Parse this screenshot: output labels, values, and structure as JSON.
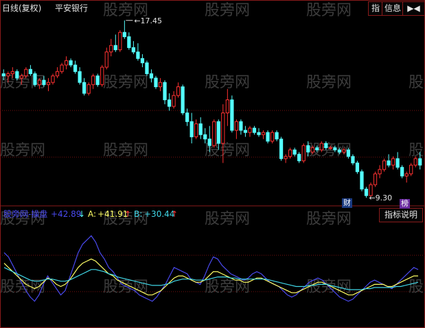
{
  "header": {
    "period_label": "日线(复权)",
    "stock_name": "平安银行"
  },
  "toolbar": {
    "zhi_label": "指",
    "info_label": "信息",
    "arrows_label": "▶◀"
  },
  "price_panel": {
    "max_label": "17.45",
    "min_label": "9.30",
    "badge_cai": "财",
    "badge_bang": "榜"
  },
  "indicator_panel": {
    "name": "股旁网-操盘",
    "value_main": "+42.89",
    "label_a": "A:",
    "value_a": "+41.91",
    "label_b": "B:",
    "value_b": "+30.44",
    "explain_button": "指标说明"
  },
  "watermark": "股旁网",
  "colors": {
    "up": "#ff3232",
    "down": "#54ffff",
    "main_line": "#4a4af0",
    "a_line": "#ffff66",
    "b_line": "#40d8e8",
    "grid": "#7a1010",
    "panel_border": "#8a1a1a"
  },
  "chart_data": [
    {
      "type": "candlestick",
      "title": "平安银行 日线(复权)",
      "x": "trading days 1-96",
      "ohlc": [
        [
          15.0,
          15.2,
          14.7,
          14.9
        ],
        [
          14.9,
          15.1,
          14.6,
          15.0
        ],
        [
          15.0,
          15.3,
          14.8,
          15.1
        ],
        [
          15.1,
          15.2,
          14.7,
          14.8
        ],
        [
          14.8,
          15.0,
          14.5,
          14.9
        ],
        [
          14.9,
          15.3,
          14.8,
          15.2
        ],
        [
          15.2,
          15.4,
          14.9,
          15.0
        ],
        [
          15.0,
          15.1,
          14.4,
          14.5
        ],
        [
          14.5,
          14.8,
          14.3,
          14.7
        ],
        [
          14.7,
          14.9,
          14.4,
          14.5
        ],
        [
          14.5,
          14.8,
          14.2,
          14.6
        ],
        [
          14.6,
          15.0,
          14.5,
          14.9
        ],
        [
          14.9,
          15.3,
          14.8,
          15.1
        ],
        [
          15.1,
          15.5,
          15.0,
          15.4
        ],
        [
          15.4,
          15.8,
          15.2,
          15.6
        ],
        [
          15.6,
          15.7,
          15.3,
          15.4
        ],
        [
          15.4,
          15.6,
          15.0,
          15.1
        ],
        [
          15.1,
          15.3,
          14.5,
          14.6
        ],
        [
          14.6,
          14.8,
          14.0,
          14.1
        ],
        [
          14.1,
          14.6,
          14.0,
          14.5
        ],
        [
          14.5,
          15.0,
          14.3,
          14.9
        ],
        [
          14.9,
          15.0,
          14.4,
          14.5
        ],
        [
          14.5,
          15.4,
          14.4,
          15.3
        ],
        [
          15.3,
          16.2,
          15.2,
          16.0
        ],
        [
          16.0,
          16.6,
          15.8,
          16.3
        ],
        [
          16.3,
          16.8,
          16.0,
          16.1
        ],
        [
          16.1,
          17.0,
          16.0,
          16.9
        ],
        [
          16.9,
          17.45,
          16.6,
          16.7
        ],
        [
          16.7,
          16.9,
          16.1,
          16.2
        ],
        [
          16.2,
          16.5,
          15.9,
          16.0
        ],
        [
          16.0,
          16.4,
          15.6,
          15.7
        ],
        [
          15.7,
          15.9,
          15.3,
          15.5
        ],
        [
          15.5,
          15.6,
          14.9,
          15.0
        ],
        [
          15.0,
          15.2,
          14.6,
          14.8
        ],
        [
          14.8,
          14.9,
          14.3,
          14.4
        ],
        [
          14.4,
          14.8,
          14.2,
          14.6
        ],
        [
          14.6,
          14.7,
          13.6,
          13.8
        ],
        [
          13.8,
          14.1,
          13.3,
          13.5
        ],
        [
          13.5,
          14.2,
          13.4,
          14.0
        ],
        [
          14.0,
          14.6,
          13.9,
          14.4
        ],
        [
          14.4,
          14.5,
          13.1,
          13.2
        ],
        [
          13.2,
          13.4,
          12.6,
          12.8
        ],
        [
          12.8,
          13.2,
          11.8,
          12.1
        ],
        [
          12.1,
          12.9,
          12.0,
          12.7
        ],
        [
          12.7,
          13.0,
          12.0,
          12.2
        ],
        [
          12.2,
          12.5,
          11.8,
          12.0
        ],
        [
          12.0,
          12.6,
          11.4,
          11.7
        ],
        [
          11.7,
          12.9,
          11.6,
          12.8
        ],
        [
          12.8,
          12.9,
          11.5,
          11.8
        ],
        [
          11.8,
          13.6,
          10.9,
          13.2
        ],
        [
          13.2,
          14.3,
          12.6,
          13.8
        ],
        [
          13.8,
          14.0,
          12.3,
          12.4
        ],
        [
          12.4,
          12.9,
          12.0,
          12.8
        ],
        [
          12.8,
          12.9,
          12.2,
          12.4
        ],
        [
          12.4,
          12.6,
          12.1,
          12.3
        ],
        [
          12.3,
          12.6,
          12.1,
          12.5
        ],
        [
          12.5,
          12.6,
          12.2,
          12.3
        ],
        [
          12.3,
          12.5,
          12.1,
          12.2
        ],
        [
          12.2,
          12.4,
          12.0,
          12.3
        ],
        [
          12.3,
          12.4,
          11.8,
          11.9
        ],
        [
          11.9,
          12.4,
          11.8,
          12.3
        ],
        [
          12.3,
          12.4,
          11.9,
          12.0
        ],
        [
          12.0,
          12.1,
          11.0,
          11.1
        ],
        [
          11.1,
          11.3,
          10.9,
          11.2
        ],
        [
          11.2,
          11.6,
          11.1,
          11.5
        ],
        [
          11.5,
          11.6,
          11.2,
          11.3
        ],
        [
          11.3,
          11.4,
          10.9,
          11.0
        ],
        [
          11.0,
          11.8,
          10.9,
          11.7
        ],
        [
          11.7,
          11.9,
          11.2,
          11.4
        ],
        [
          11.4,
          11.7,
          11.3,
          11.6
        ],
        [
          11.6,
          11.7,
          11.4,
          11.5
        ],
        [
          11.5,
          11.9,
          11.4,
          11.8
        ],
        [
          11.8,
          11.9,
          11.5,
          11.6
        ],
        [
          11.6,
          11.7,
          11.5,
          11.6
        ],
        [
          11.6,
          11.7,
          11.4,
          11.5
        ],
        [
          11.5,
          11.6,
          11.3,
          11.4
        ],
        [
          11.4,
          11.6,
          11.3,
          11.5
        ],
        [
          11.5,
          11.6,
          11.1,
          11.2
        ],
        [
          11.2,
          11.3,
          10.8,
          10.9
        ],
        [
          10.9,
          11.0,
          10.4,
          10.5
        ],
        [
          10.5,
          10.6,
          9.6,
          9.7
        ],
        [
          9.7,
          9.8,
          9.3,
          9.4
        ],
        [
          9.4,
          10.0,
          9.35,
          9.9
        ],
        [
          9.9,
          10.5,
          9.8,
          10.4
        ],
        [
          10.4,
          10.8,
          10.2,
          10.6
        ],
        [
          10.6,
          11.1,
          10.5,
          11.0
        ],
        [
          11.0,
          11.3,
          10.7,
          10.8
        ],
        [
          10.8,
          11.2,
          10.6,
          11.1
        ],
        [
          11.1,
          11.4,
          10.6,
          10.7
        ],
        [
          10.7,
          10.8,
          10.2,
          10.3
        ],
        [
          10.3,
          10.5,
          10.0,
          10.4
        ],
        [
          10.4,
          10.9,
          10.3,
          10.8
        ],
        [
          10.8,
          11.2,
          10.7,
          11.1
        ],
        [
          11.1,
          11.4,
          10.6,
          10.8
        ]
      ],
      "annotations": [
        {
          "label": "17.45",
          "value": 17.45
        },
        {
          "label": "9.30",
          "value": 9.3
        }
      ],
      "xlabel": "",
      "ylabel": ""
    },
    {
      "type": "line",
      "title": "股旁网-操盘",
      "ylim": [
        0,
        100
      ],
      "series": [
        {
          "name": "main",
          "values": [
            70,
            66,
            58,
            50,
            42,
            34,
            28,
            24,
            30,
            40,
            48,
            42,
            36,
            30,
            34,
            46,
            58,
            70,
            78,
            82,
            86,
            80,
            70,
            64,
            56,
            52,
            46,
            40,
            38,
            36,
            34,
            30,
            28,
            26,
            24,
            28,
            34,
            40,
            48,
            56,
            54,
            52,
            50,
            44,
            42,
            40,
            48,
            58,
            66,
            64,
            58,
            54,
            50,
            48,
            46,
            44,
            46,
            50,
            52,
            50,
            46,
            42,
            40,
            38,
            34,
            30,
            28,
            30,
            34,
            38,
            42,
            44,
            46,
            44,
            40,
            36,
            32,
            28,
            26,
            24,
            26,
            30,
            34,
            38,
            42,
            44,
            42,
            40,
            38,
            36,
            40,
            44,
            48,
            52,
            56,
            54
          ]
        },
        {
          "name": "A",
          "values": [
            60,
            56,
            52,
            48,
            44,
            40,
            38,
            36,
            38,
            42,
            46,
            44,
            40,
            38,
            40,
            44,
            50,
            56,
            60,
            62,
            64,
            62,
            58,
            54,
            50,
            48,
            44,
            42,
            40,
            38,
            36,
            34,
            32,
            30,
            30,
            32,
            34,
            38,
            42,
            46,
            48,
            48,
            46,
            44,
            42,
            42,
            44,
            48,
            52,
            52,
            50,
            48,
            46,
            44,
            44,
            42,
            42,
            44,
            46,
            46,
            44,
            42,
            40,
            38,
            36,
            34,
            32,
            32,
            34,
            36,
            38,
            40,
            42,
            42,
            40,
            38,
            36,
            34,
            32,
            30,
            30,
            32,
            34,
            36,
            38,
            40,
            40,
            40,
            38,
            38,
            40,
            42,
            44,
            46,
            48,
            48
          ]
        },
        {
          "name": "B",
          "values": [
            56,
            54,
            52,
            50,
            48,
            46,
            44,
            43,
            43,
            44,
            45,
            45,
            44,
            43,
            43,
            44,
            46,
            48,
            50,
            52,
            54,
            54,
            53,
            52,
            50,
            49,
            47,
            46,
            45,
            44,
            43,
            42,
            41,
            40,
            39,
            39,
            39,
            40,
            41,
            43,
            44,
            45,
            45,
            45,
            44,
            44,
            44,
            45,
            46,
            47,
            47,
            47,
            46,
            46,
            45,
            45,
            45,
            45,
            45,
            45,
            45,
            44,
            43,
            42,
            41,
            40,
            39,
            38,
            38,
            38,
            39,
            39,
            40,
            40,
            40,
            39,
            38,
            37,
            36,
            35,
            35,
            35,
            35,
            36,
            36,
            37,
            37,
            37,
            37,
            37,
            38,
            38,
            39,
            40,
            41,
            42
          ]
        }
      ]
    }
  ]
}
